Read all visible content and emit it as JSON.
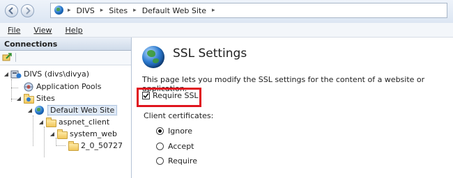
{
  "address_bar": {
    "breadcrumbs": [
      "DIVS",
      "Sites",
      "Default Web Site"
    ]
  },
  "menu": {
    "file": "File",
    "view": "View",
    "help": "Help"
  },
  "connections": {
    "header": "Connections",
    "tree": {
      "server": "DIVS (divs\\divya)",
      "app_pools": "Application Pools",
      "sites": "Sites",
      "default_site": "Default Web Site",
      "aspnet_client": "aspnet_client",
      "system_web": "system_web",
      "version_folder": "2_0_50727"
    }
  },
  "content": {
    "title": "SSL Settings",
    "description": "This page lets you modify the SSL settings for the content of a website or application.",
    "require_ssl_label": "Require SSL",
    "require_ssl_checked": true,
    "client_certificates_label": "Client certificates:",
    "client_cert_options": [
      "Ignore",
      "Accept",
      "Require"
    ],
    "client_cert_selected": "Ignore"
  },
  "colors": {
    "highlight_box": "#e0141e"
  }
}
